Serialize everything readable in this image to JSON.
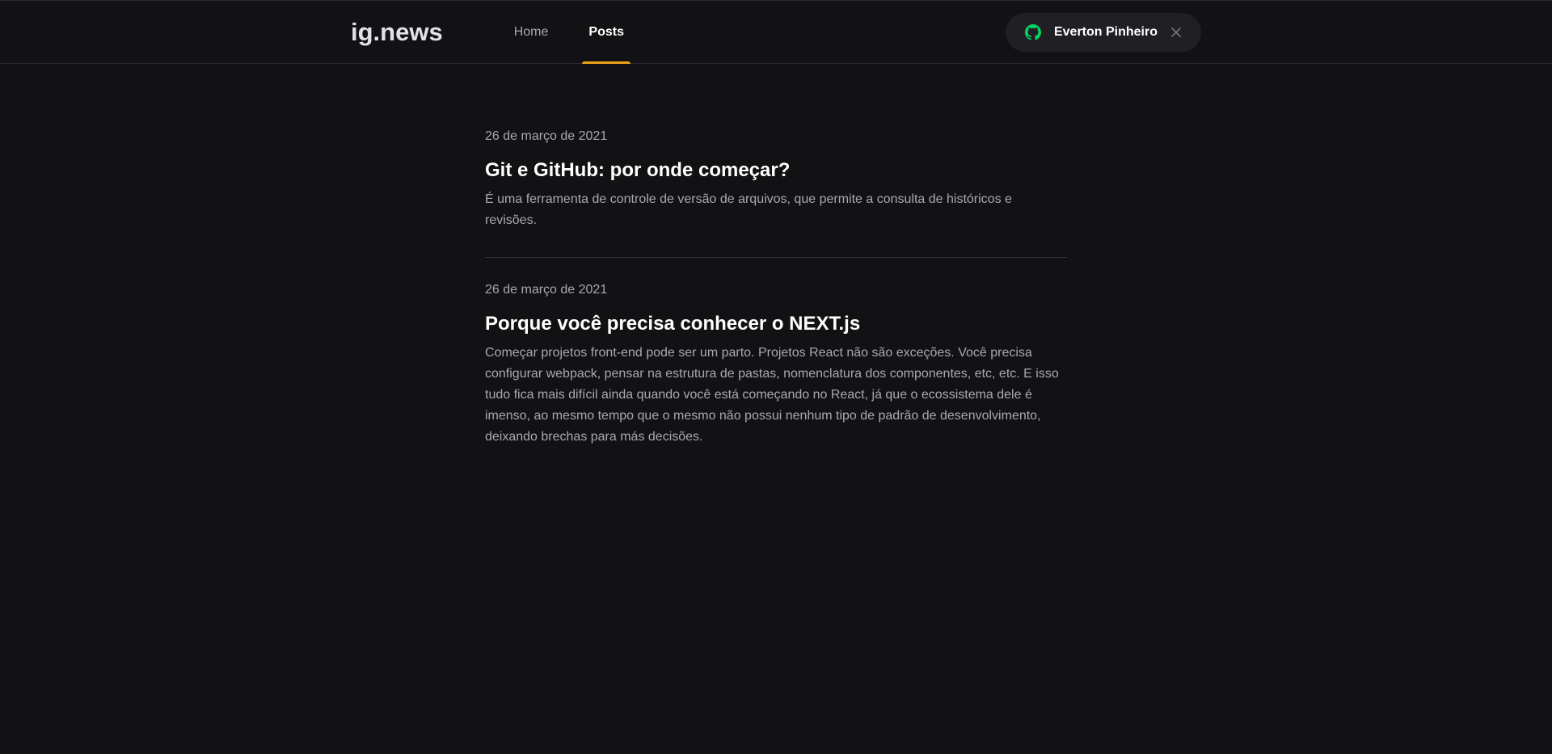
{
  "header": {
    "logo": "ig.news",
    "nav": [
      {
        "label": "Home",
        "active": false
      },
      {
        "label": "Posts",
        "active": true
      }
    ],
    "user": {
      "name": "Everton Pinheiro",
      "icon": "github-icon",
      "close_icon": "close-icon"
    }
  },
  "colors": {
    "background": "#121214",
    "accent": "#eba417",
    "github_green": "#04d361",
    "text_muted": "#a8a8b3"
  },
  "posts": [
    {
      "date": "26 de março de 2021",
      "title": "Git e GitHub: por onde começar?",
      "excerpt": "É uma ferramenta de controle de versão de arquivos, que permite a consulta de históricos e revisões."
    },
    {
      "date": "26 de março de 2021",
      "title": "Porque você precisa conhecer o NEXT.js",
      "excerpt": "Começar projetos front-end pode ser um parto. Projetos React não são exceções. Você precisa configurar webpack, pensar na estrutura de pastas, nomenclatura dos componentes, etc, etc. E isso tudo fica mais difícil ainda quando você está começando no React, já que o ecossistema dele é imenso, ao mesmo tempo que o mesmo não possui nenhum tipo de padrão de desenvolvimento, deixando brechas para más decisões."
    }
  ]
}
